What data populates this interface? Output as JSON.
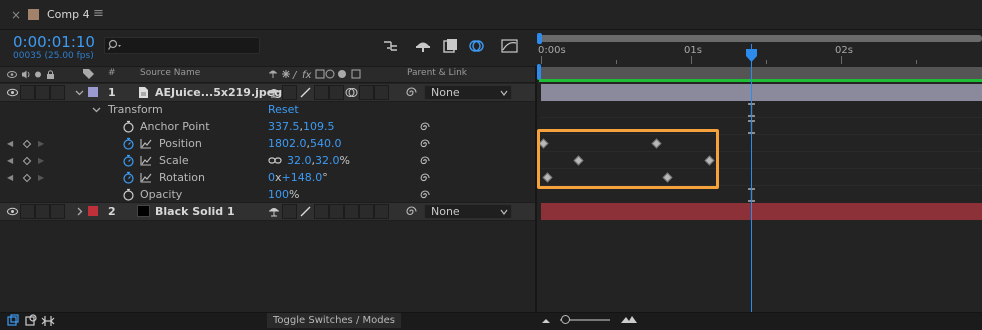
{
  "tab": {
    "close": "×",
    "title": "Comp 4",
    "menu": "≡"
  },
  "header": {
    "timecode": "0:00:01:10",
    "frame_info": "00035 (25.00 fps)",
    "search_placeholder": ""
  },
  "ruler": {
    "labels": [
      "0:00s",
      "01s",
      "02s"
    ]
  },
  "columns": {
    "source_name": "Source Name",
    "num": "#",
    "parent_link": "Parent & Link"
  },
  "layers": [
    {
      "index": "1",
      "name": "AEJuice...5x219.jpeg",
      "parent": "None",
      "color": "#9a9ad0"
    },
    {
      "index": "2",
      "name": "Black Solid 1",
      "parent": "None",
      "color": "#c0303a"
    }
  ],
  "transform": {
    "label": "Transform",
    "reset": "Reset",
    "properties": [
      {
        "name": "Anchor Point",
        "v1": "337.5",
        "sep": ",",
        "v2": "109.5",
        "suffix": ""
      },
      {
        "name": "Position",
        "v1": "1802.0",
        "sep": ",",
        "v2": "540.0",
        "suffix": ""
      },
      {
        "name": "Scale",
        "v1": "32.0",
        "sep": ",",
        "v2": "32.0",
        "suffix": "%"
      },
      {
        "name": "Rotation",
        "v1": "0",
        "sep": "x",
        "v2": "+148.0",
        "suffix": "°"
      },
      {
        "name": "Opacity",
        "v1": "100",
        "sep": "",
        "v2": "",
        "suffix": "%"
      }
    ]
  },
  "bottom": {
    "toggle": "Toggle Switches / Modes"
  },
  "colors": {
    "accent": "#2d8ceb",
    "highlight": "#f5a23c",
    "green": "#1fbd36",
    "layer1_bar": "#8a8a9c",
    "layer2_bar": "#8c3138"
  }
}
